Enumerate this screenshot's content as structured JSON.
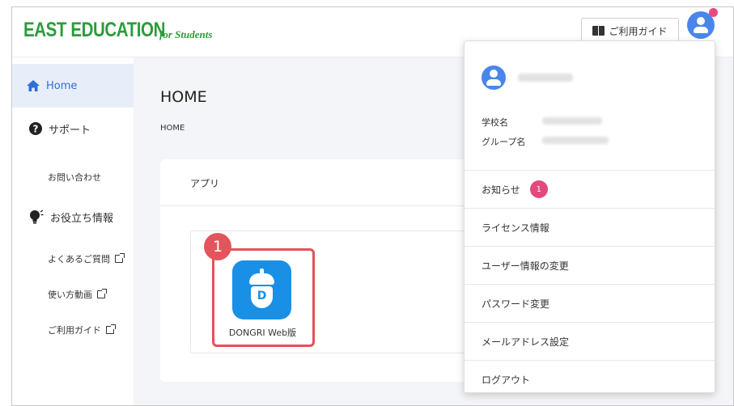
{
  "header": {
    "logo": "EAST EDUCATION",
    "logo_sub": "for Students",
    "guide_button": "ご利用ガイド"
  },
  "sidebar": {
    "items": [
      {
        "label": "Home",
        "icon": "home-icon"
      },
      {
        "label": "サポート",
        "icon": "question-circle-icon"
      },
      {
        "label": "お問い合わせ"
      },
      {
        "label": "お役立ち情報",
        "icon": "lightbulb-icon"
      },
      {
        "label": "よくあるご質問"
      },
      {
        "label": "使い方動画"
      },
      {
        "label": "ご利用ガイド"
      }
    ]
  },
  "main": {
    "title": "HOME",
    "breadcrumb": "HOME",
    "card_title": "アプリ",
    "app_label": "DONGRI Web版",
    "step_number": "1"
  },
  "dropdown": {
    "school_label": "学校名",
    "group_label": "グループ名",
    "items": [
      {
        "label": "お知らせ",
        "badge": "1"
      },
      {
        "label": "ライセンス情報"
      },
      {
        "label": "ユーザー情報の変更"
      },
      {
        "label": "パスワード変更"
      },
      {
        "label": "メールアドレス設定"
      },
      {
        "label": "ログアウト"
      }
    ]
  },
  "colors": {
    "brand_green": "#2c9c3a",
    "accent_blue": "#4a86e8",
    "highlight_red": "#e3525a",
    "badge_pink": "#e34a7c"
  }
}
